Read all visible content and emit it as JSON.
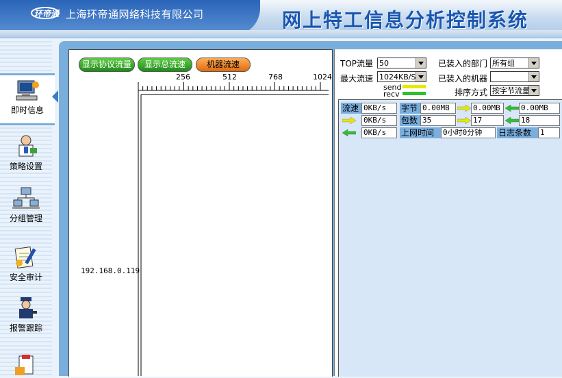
{
  "header": {
    "company": "上海环帝通网络科技有限公司",
    "system_title": "网上特工信息分析控制系统",
    "colors": {
      "brand_blue": "#2a64b8",
      "title_blue": "#1a56b0"
    }
  },
  "nav": {
    "items": [
      {
        "label": "即时信息",
        "icon": "monitor-icon",
        "active": true
      },
      {
        "label": "策略设置",
        "icon": "doctor-icon",
        "active": false
      },
      {
        "label": "分组管理",
        "icon": "network-computers-icon",
        "active": false
      },
      {
        "label": "安全审计",
        "icon": "audit-pen-icon",
        "active": false
      },
      {
        "label": "报警跟踪",
        "icon": "police-icon",
        "active": false
      }
    ]
  },
  "chart": {
    "buttons": {
      "protocol": "显示协议流量",
      "total": "显示总流速",
      "machine": "机器流速"
    },
    "scale_labels": [
      "256",
      "512",
      "768",
      "1024"
    ],
    "ip": "192.168.0.119"
  },
  "controls": {
    "top_label": "TOP流量",
    "top_value": "50",
    "max_label": "最大流速",
    "max_value": "1024KB/S",
    "dept_label": "已装入的部门",
    "dept_value": "所有组",
    "machine_label": "已装入的机器",
    "machine_value": "",
    "sort_label": "排序方式",
    "sort_value": "按字节流量",
    "legend": {
      "send": "send",
      "recv": "recv",
      "send_color": "#e8e800",
      "recv_color": "#2ec02e"
    }
  },
  "stats": {
    "speed_label": "流速",
    "speed": "0KB/s",
    "bytes_label": "字节",
    "bytes": "0.00MB",
    "bytes_send": "0.00MB",
    "bytes_recv": "0.00MB",
    "speed_send": "0KB/s",
    "packets_label": "包数",
    "packets": "35",
    "packets_send": "17",
    "packets_recv": "18",
    "speed_recv": "0KB/s",
    "online_label": "上网时间",
    "online": "0小时0分钟",
    "log_label": "日志条数",
    "log": "1"
  }
}
